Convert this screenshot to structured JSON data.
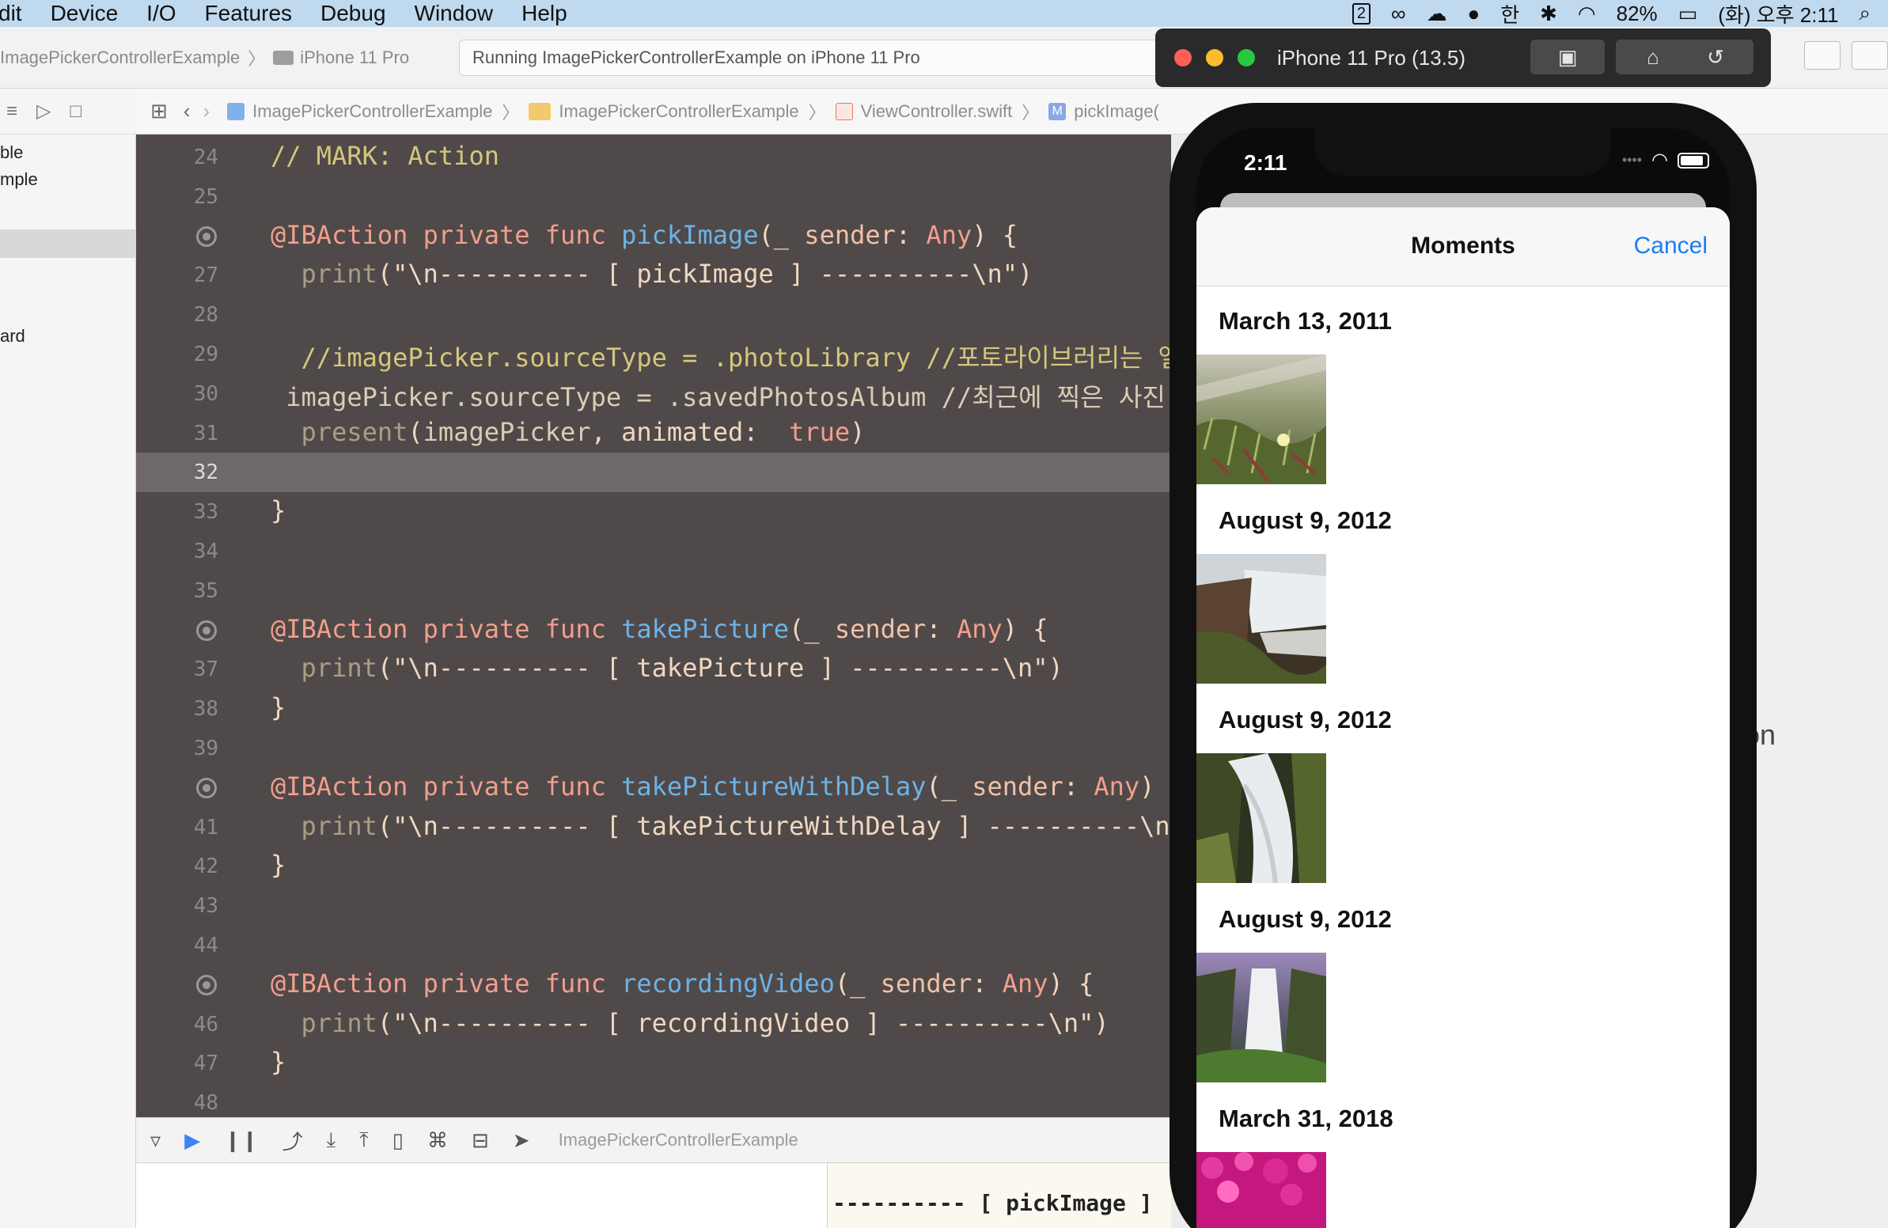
{
  "menubar": {
    "menus": [
      "dit",
      "Device",
      "I/O",
      "Features",
      "Debug",
      "Window",
      "Help"
    ],
    "status": {
      "battery": "82%",
      "clock": "(화) 오후 2:11",
      "desktop_number": "2"
    }
  },
  "toolbar": {
    "scheme_target": "ImagePickerControllerExample",
    "scheme_device": "iPhone 11 Pro",
    "run_status": "Running ImagePickerControllerExample on iPhone 11 Pro"
  },
  "navigator": {
    "items": [
      "ble",
      "mple",
      "ard"
    ]
  },
  "jumpbar": {
    "crumbs": [
      "ImagePickerControllerExample",
      "ImagePickerControllerExample",
      "ViewController.swift",
      "pickImage("
    ]
  },
  "editor": {
    "lines": [
      {
        "no": "24",
        "segments": [
          {
            "cls": "comment",
            "t": "// MARK: Action"
          }
        ]
      },
      {
        "no": "25",
        "segments": []
      },
      {
        "no": "26",
        "bp": true,
        "segments": [
          {
            "cls": "kw",
            "t": "@IBAction private func "
          },
          {
            "cls": "fn",
            "t": "pickImage"
          },
          {
            "cls": "str",
            "t": "(_ "
          },
          {
            "cls": "type",
            "t": "sender"
          },
          {
            "cls": "str",
            "t": ": "
          },
          {
            "cls": "kw",
            "t": "Any"
          },
          {
            "cls": "str",
            "t": ") {"
          }
        ]
      },
      {
        "no": "27",
        "segments": [
          {
            "cls": "str",
            "t": "  "
          },
          {
            "cls": "prn",
            "t": "print"
          },
          {
            "cls": "str",
            "t": "(\"\\n---------- [ pickImage ] ----------\\n\")"
          }
        ]
      },
      {
        "no": "28",
        "segments": []
      },
      {
        "no": "29",
        "segments": [
          {
            "cls": "comment",
            "t": "  //imagePicker.sourceType = .photoLibrary //포토라이브러리는 앨범선택"
          }
        ]
      },
      {
        "no": "30",
        "segments": [
          {
            "cls": "vr",
            "t": " imagePicker.sourceType = .savedPhotosAlbum //최근에 찍은 사진 위주로"
          }
        ]
      },
      {
        "no": "31",
        "segments": [
          {
            "cls": "str",
            "t": "  "
          },
          {
            "cls": "prn",
            "t": "present"
          },
          {
            "cls": "str",
            "t": "("
          },
          {
            "cls": "vr",
            "t": "imagePicker"
          },
          {
            "cls": "str",
            "t": ", animated:  "
          },
          {
            "cls": "kw",
            "t": "true"
          },
          {
            "cls": "str",
            "t": ")"
          }
        ]
      },
      {
        "no": "32",
        "current": true,
        "segments": []
      },
      {
        "no": "33",
        "segments": [
          {
            "cls": "str",
            "t": "}"
          }
        ]
      },
      {
        "no": "34",
        "segments": []
      },
      {
        "no": "35",
        "segments": []
      },
      {
        "no": "36",
        "bp": true,
        "segments": [
          {
            "cls": "kw",
            "t": "@IBAction private func "
          },
          {
            "cls": "fn",
            "t": "takePicture"
          },
          {
            "cls": "str",
            "t": "(_ "
          },
          {
            "cls": "type",
            "t": "sender"
          },
          {
            "cls": "str",
            "t": ": "
          },
          {
            "cls": "kw",
            "t": "Any"
          },
          {
            "cls": "str",
            "t": ") {"
          }
        ]
      },
      {
        "no": "37",
        "segments": [
          {
            "cls": "str",
            "t": "  "
          },
          {
            "cls": "prn",
            "t": "print"
          },
          {
            "cls": "str",
            "t": "(\"\\n---------- [ takePicture ] ----------\\n\")"
          }
        ]
      },
      {
        "no": "38",
        "segments": [
          {
            "cls": "str",
            "t": "}"
          }
        ]
      },
      {
        "no": "39",
        "segments": []
      },
      {
        "no": "40",
        "bp": true,
        "segments": [
          {
            "cls": "kw",
            "t": "@IBAction private func "
          },
          {
            "cls": "fn",
            "t": "takePictureWithDelay"
          },
          {
            "cls": "str",
            "t": "(_ "
          },
          {
            "cls": "type",
            "t": "sender"
          },
          {
            "cls": "str",
            "t": ": "
          },
          {
            "cls": "kw",
            "t": "Any"
          },
          {
            "cls": "str",
            "t": ") {"
          }
        ]
      },
      {
        "no": "41",
        "segments": [
          {
            "cls": "str",
            "t": "  "
          },
          {
            "cls": "prn",
            "t": "print"
          },
          {
            "cls": "str",
            "t": "(\"\\n---------- [ takePictureWithDelay ] ----------\\n\")"
          }
        ]
      },
      {
        "no": "42",
        "segments": [
          {
            "cls": "str",
            "t": "}"
          }
        ]
      },
      {
        "no": "43",
        "segments": []
      },
      {
        "no": "44",
        "segments": []
      },
      {
        "no": "45",
        "bp": true,
        "segments": [
          {
            "cls": "kw",
            "t": "@IBAction private func "
          },
          {
            "cls": "fn",
            "t": "recordingVideo"
          },
          {
            "cls": "str",
            "t": "(_ "
          },
          {
            "cls": "type",
            "t": "sender"
          },
          {
            "cls": "str",
            "t": ": "
          },
          {
            "cls": "kw",
            "t": "Any"
          },
          {
            "cls": "str",
            "t": ") {"
          }
        ]
      },
      {
        "no": "46",
        "segments": [
          {
            "cls": "str",
            "t": "  "
          },
          {
            "cls": "prn",
            "t": "print"
          },
          {
            "cls": "str",
            "t": "(\"\\n---------- [ recordingVideo ] ----------\\n\")"
          }
        ]
      },
      {
        "no": "47",
        "segments": [
          {
            "cls": "str",
            "t": "}"
          }
        ]
      },
      {
        "no": "48",
        "segments": []
      }
    ]
  },
  "debugbar": {
    "target": "ImagePickerControllerExample"
  },
  "console": {
    "output": "---------- [ pickImage ]"
  },
  "inspector": {
    "partial_text": "tion"
  },
  "simulator": {
    "title": "iPhone 11 Pro (13.5)",
    "time": "2:11",
    "picker": {
      "title": "Moments",
      "cancel_label": "Cancel",
      "moments": [
        {
          "date": "March 13, 2011",
          "thumb": "flower-meadow"
        },
        {
          "date": "August 9, 2012",
          "thumb": "waterfall-cliff"
        },
        {
          "date": "August 9, 2012",
          "thumb": "mossy-cascade"
        },
        {
          "date": "August 9, 2012",
          "thumb": "tall-waterfall"
        },
        {
          "date": "March 31, 2018",
          "thumb": "pink-flowers"
        }
      ]
    }
  },
  "colors": {
    "editor_bg": "#504949",
    "keyword": "#f19f8d",
    "function": "#6cb3e6",
    "comment": "#d4c77d",
    "ios_blue": "#1a7cf5",
    "menubar": "#bfd9ee"
  }
}
